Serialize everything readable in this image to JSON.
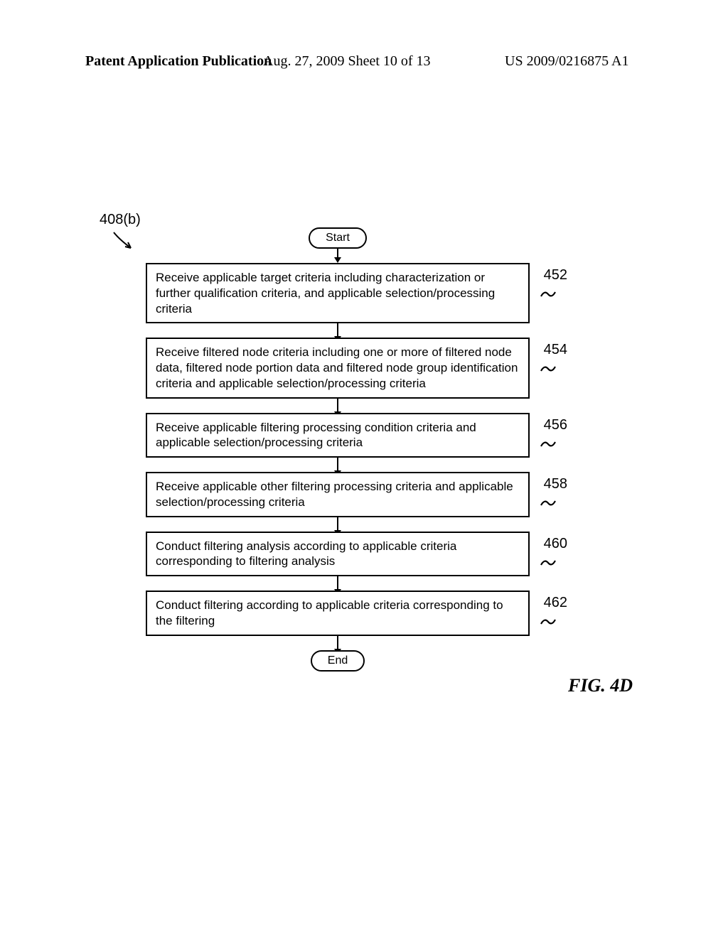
{
  "header": {
    "left": "Patent Application Publication",
    "mid": "Aug. 27, 2009  Sheet 10 of 13",
    "right": "US 2009/0216875 A1"
  },
  "flowchart": {
    "ref": "408(b)",
    "start": "Start",
    "end": "End",
    "figure_label": "FIG. 4D",
    "steps": [
      {
        "num": "452",
        "text": "Receive applicable target criteria including characterization or further qualification criteria, and applicable selection/processing criteria"
      },
      {
        "num": "454",
        "text": "Receive filtered node criteria including one or more of filtered node data, filtered node portion data and filtered node group identification criteria and applicable selection/processing criteria"
      },
      {
        "num": "456",
        "text": "Receive applicable filtering processing condition criteria and applicable selection/processing criteria"
      },
      {
        "num": "458",
        "text": "Receive applicable other filtering processing criteria and applicable selection/processing criteria"
      },
      {
        "num": "460",
        "text": "Conduct filtering analysis according to applicable criteria corresponding to filtering analysis"
      },
      {
        "num": "462",
        "text": "Conduct filtering according to applicable criteria corresponding to the filtering"
      }
    ]
  }
}
